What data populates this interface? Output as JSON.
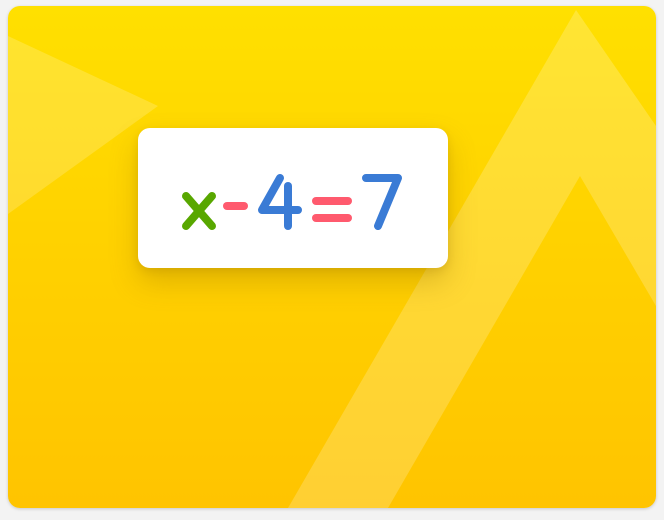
{
  "equation": {
    "tokens": [
      {
        "name": "variable-x",
        "text": "x",
        "color": "#58a700"
      },
      {
        "name": "operator-minus",
        "text": "-",
        "color": "#ff5a6e"
      },
      {
        "name": "number-4",
        "text": "4",
        "color": "#3a7bd5"
      },
      {
        "name": "operator-equals",
        "text": "=",
        "color": "#ff5a6e"
      },
      {
        "name": "number-7",
        "text": "7",
        "color": "#3a7bd5"
      }
    ]
  },
  "colors": {
    "background_top": "#ffe000",
    "background_bottom": "#ffc400",
    "card": "#ffffff"
  }
}
